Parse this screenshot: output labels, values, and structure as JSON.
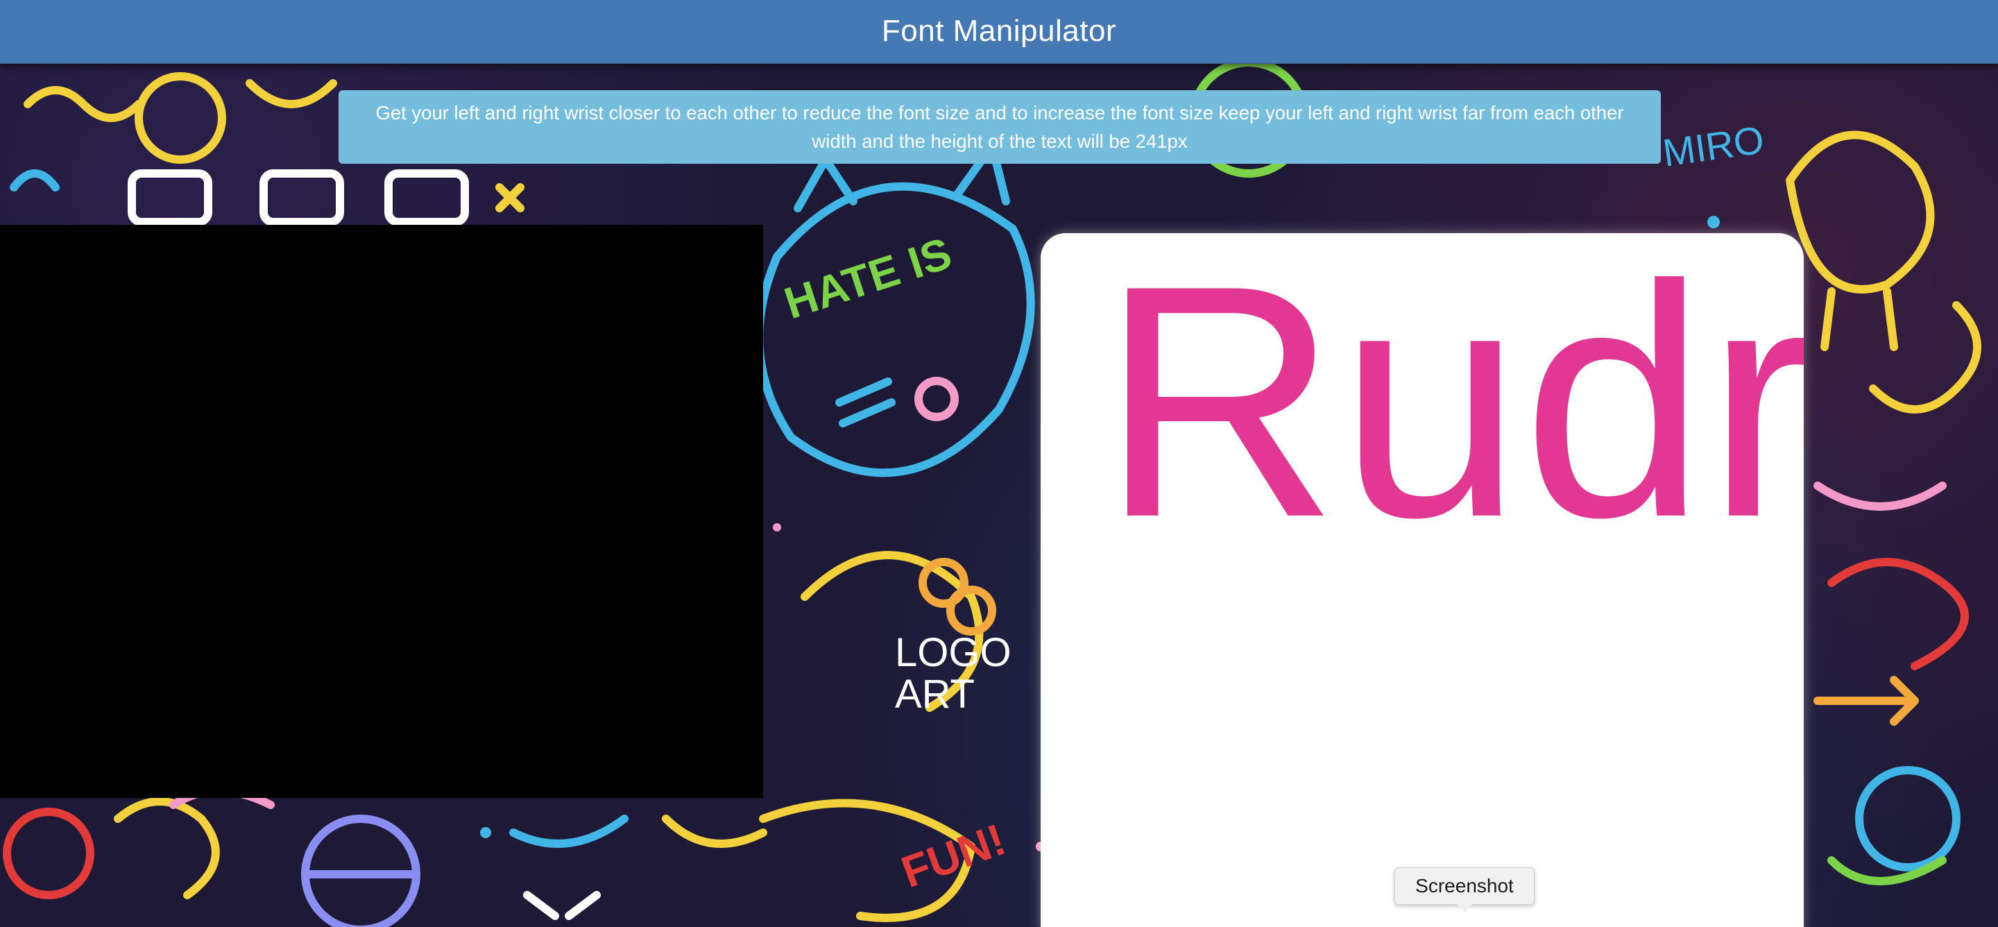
{
  "app": {
    "title": "Font Manipulator"
  },
  "instructions": {
    "line1": "Get your left and right wrist closer to each other to reduce the font size and to increase the font size keep your left and right wrist far from each other",
    "line2": "width and the height of the text will be 241px"
  },
  "video": {
    "state": "black"
  },
  "preview": {
    "text": "Rudr",
    "text_color": "#e23793"
  },
  "tooltip": {
    "label": "Screenshot"
  },
  "colors": {
    "navbar": "#4479b4",
    "banner": "#75bddc",
    "card": "#ffffff"
  }
}
